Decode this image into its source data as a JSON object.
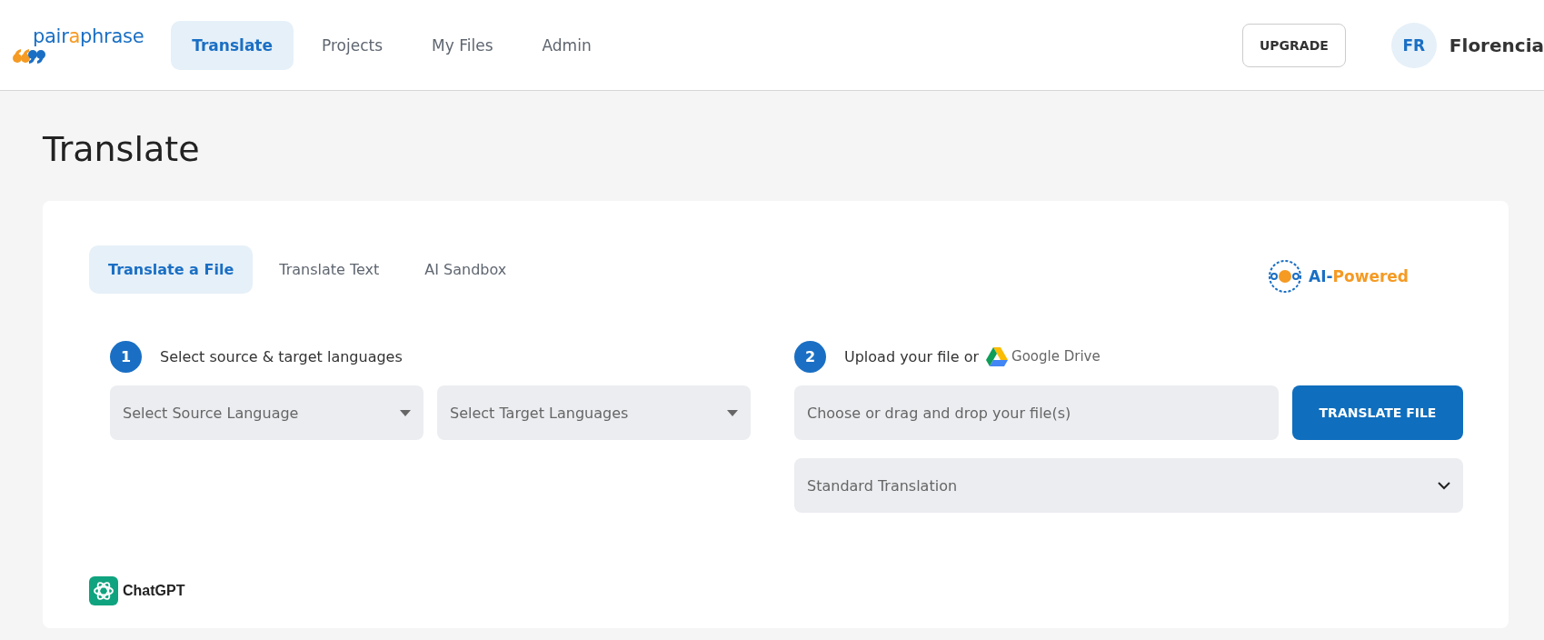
{
  "header": {
    "logo": [
      {
        "text": "pair",
        "color": "#1a6fc4"
      },
      {
        "text": "a",
        "color": "#f59a23"
      },
      {
        "text": "phrase",
        "color": "#1a6fc4"
      }
    ],
    "nav": [
      {
        "label": "Translate",
        "selected": true
      },
      {
        "label": "Projects",
        "selected": false
      },
      {
        "label": "My Files",
        "selected": false
      },
      {
        "label": "Admin",
        "selected": false
      }
    ],
    "upgrade_button": "UPGRADE",
    "user": {
      "initials": "FR",
      "name": "Florencia"
    }
  },
  "page_title": "Translate",
  "card": {
    "tabs": [
      {
        "label": "Translate a File",
        "selected": true
      },
      {
        "label": "Translate Text",
        "selected": false
      },
      {
        "label": "AI Sandbox",
        "selected": false
      }
    ],
    "ai_badge": [
      {
        "text": "AI-",
        "color": "#1a6fc4"
      },
      {
        "text": "Powered",
        "color": "#f59a23"
      }
    ],
    "step_1": {
      "number": "1",
      "label": "Select source & target languages",
      "source_placeholder": "Select Source Language",
      "target_placeholder": "Select Target Languages"
    },
    "step_2": {
      "number": "2",
      "label": "Upload your file or",
      "drive_label": "Google Drive",
      "file_placeholder": "Choose or drag and drop your file(s)",
      "translate_button": "TRANSLATE FILE",
      "mode": "Standard Translation"
    },
    "engine": "ChatGPT"
  }
}
